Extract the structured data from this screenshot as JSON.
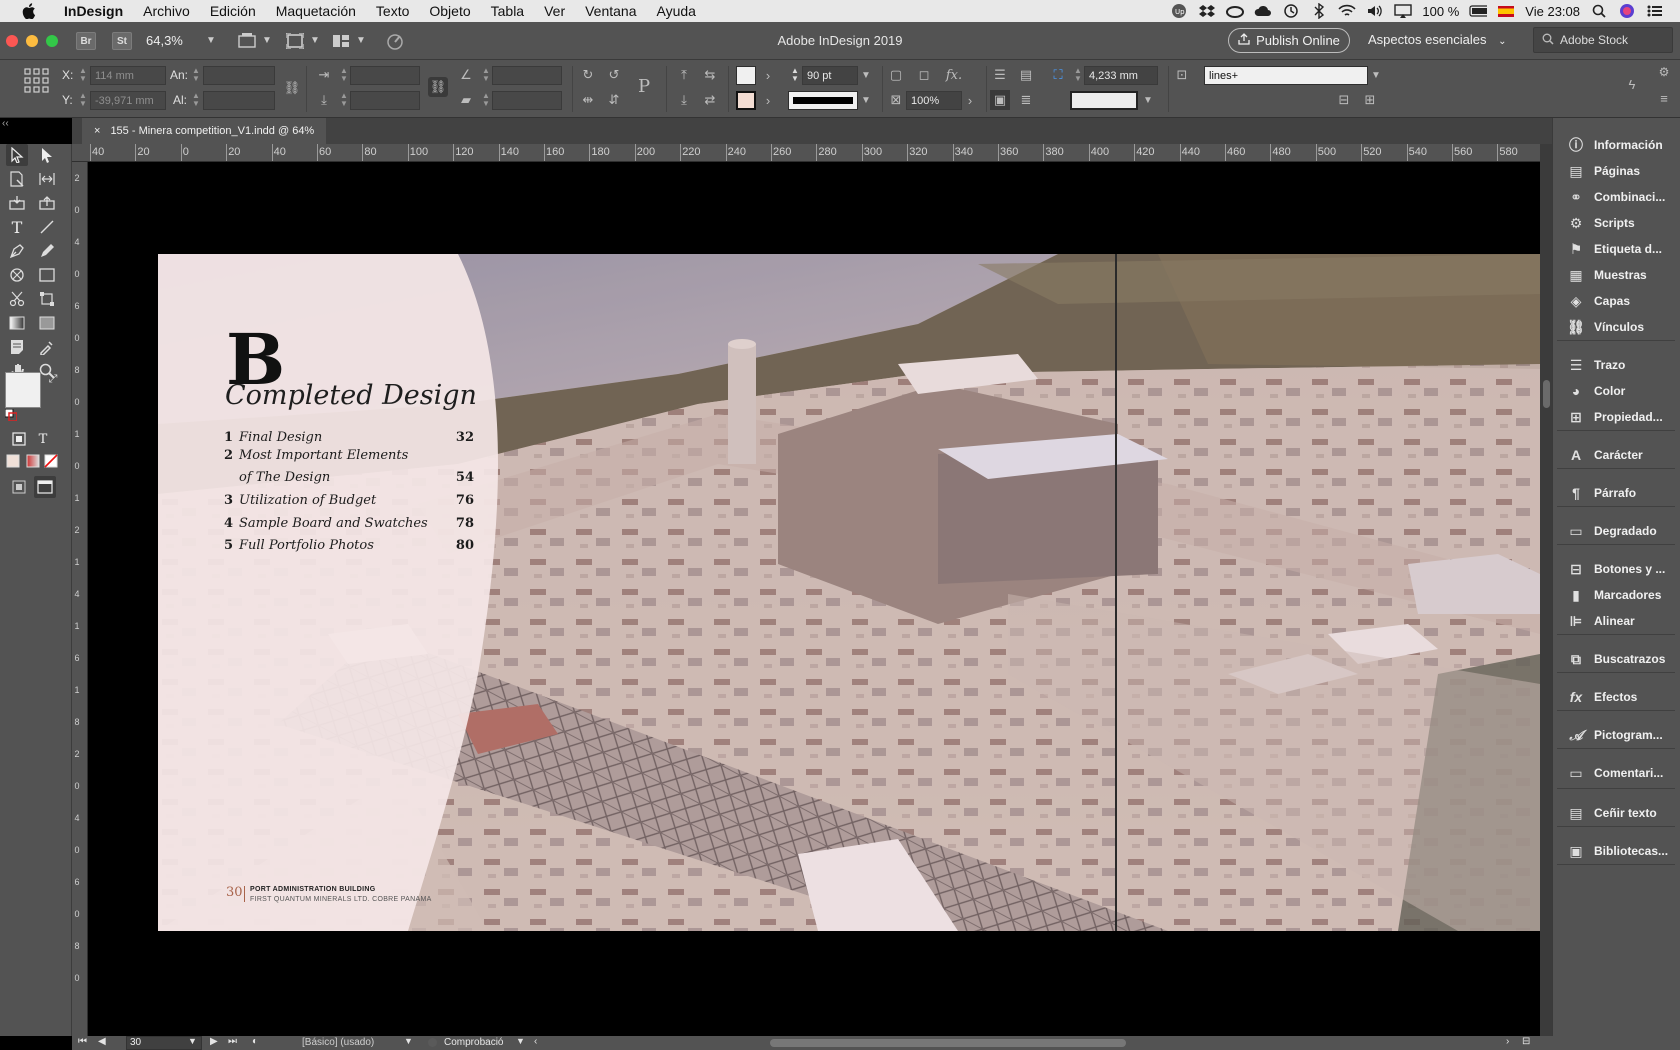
{
  "menubar": {
    "app_name": "InDesign",
    "items": [
      "Archivo",
      "Edición",
      "Maquetación",
      "Texto",
      "Objeto",
      "Tabla",
      "Ver",
      "Ventana",
      "Ayuda"
    ],
    "battery": "100 %",
    "clock": "Vie 23:08"
  },
  "appbar": {
    "title": "Adobe InDesign 2019",
    "zoom": "64,3%",
    "bridge_label": "Br",
    "stock_label": "St",
    "publish_label": "Publish Online",
    "workspace": "Aspectos esenciales",
    "search_placeholder": "Adobe Stock"
  },
  "control_panel": {
    "x_label": "X:",
    "y_label": "Y:",
    "x_value": "114 mm",
    "y_value": "-39,971 mm",
    "w_label": "An:",
    "h_label": "Al:",
    "stroke_weight": "90 pt",
    "opacity": "100%",
    "offset": "4,233 mm",
    "object_style": "lines+"
  },
  "document": {
    "tab_title": "155 - Minera competition_V1.indd @ 64%",
    "close_glyph": "×"
  },
  "ruler": {
    "top": [
      "40",
      "20",
      "0",
      "20",
      "40",
      "60",
      "80",
      "100",
      "120",
      "140",
      "160",
      "180",
      "200",
      "220",
      "240",
      "260",
      "280",
      "300",
      "320",
      "340",
      "360",
      "380",
      "400",
      "420",
      "440",
      "460",
      "480",
      "500",
      "520",
      "540",
      "560",
      "580"
    ],
    "left": [
      "2",
      "0",
      "4",
      "0",
      "6",
      "0",
      "8",
      "0",
      "1",
      "0",
      "1",
      "2",
      "1",
      "4",
      "1",
      "6",
      "1",
      "8",
      "2",
      "0",
      "4",
      "0",
      "6",
      "0",
      "8",
      "0"
    ]
  },
  "page": {
    "letter": "B",
    "title": "Completed Design",
    "toc": [
      {
        "num": "1",
        "text": "Final Design",
        "page": "32"
      },
      {
        "num": "2",
        "text": "Most Important Elements",
        "page": ""
      },
      {
        "num": "",
        "text": "of The Design",
        "page": "54"
      },
      {
        "num": "3",
        "text": "Utilization of Budget",
        "page": "76"
      },
      {
        "num": "4",
        "text": "Sample Board and Swatches",
        "page": "78"
      },
      {
        "num": "5",
        "text": "Full Portfolio Photos",
        "page": "80"
      }
    ],
    "folio_number": "30",
    "folio_line1": "PORT ADMINISTRATION BUILDING",
    "folio_line2": "FIRST QUANTUM MINERALS LTD. COBRE PANAMA"
  },
  "dock": {
    "items": [
      "Información",
      "Páginas",
      "Combinaci...",
      "Scripts",
      "Etiqueta d...",
      "Muestras",
      "Capas",
      "Vínculos",
      "Trazo",
      "Color",
      "Propiedad...",
      "Carácter",
      "Párrafo",
      "Degradado",
      "Botones y ...",
      "Marcadores",
      "Alinear",
      "Buscatrazos",
      "Efectos",
      "Pictogram...",
      "Comentari...",
      "Ceñir texto",
      "Bibliotecas..."
    ]
  },
  "statusbar": {
    "page": "30",
    "master": "[Básico] (usado)",
    "preflight": "Comprobació"
  },
  "colors": {
    "ui_panel": "#535353",
    "pasteboard": "#000000",
    "page_overlay": "#f3e4e4",
    "folio_accent": "#a8634a"
  }
}
